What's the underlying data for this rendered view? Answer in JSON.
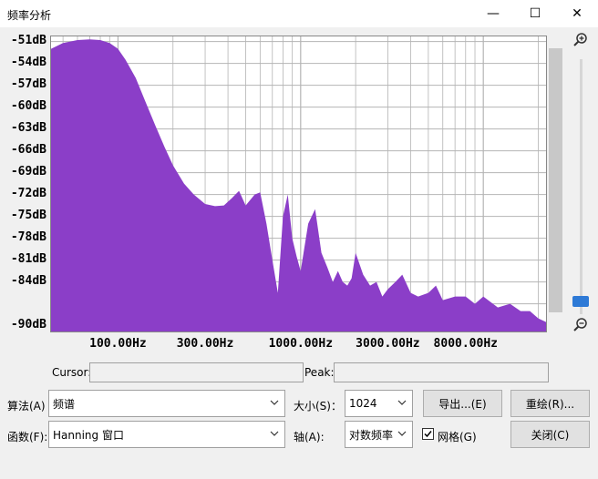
{
  "window": {
    "title": "频率分析",
    "minimize": "—",
    "maximize": "☐",
    "close": "✕"
  },
  "colors": {
    "spectrum": "#8b3ec8",
    "grid": "#b4b4b4"
  },
  "chart_data": {
    "type": "area",
    "y_tick_labels": [
      "-51dB",
      "-54dB",
      "-57dB",
      "-60dB",
      "-63dB",
      "-66dB",
      "-69dB",
      "-72dB",
      "-75dB",
      "-78dB",
      "-81dB",
      "-84dB",
      "-90dB"
    ],
    "x_tick_labels": [
      "100.00Hz",
      "300.00Hz",
      "1000.00Hz",
      "3000.00Hz",
      "8000.00Hz"
    ],
    "ylim": [
      -90,
      -51
    ],
    "xlim_hz": [
      43,
      22050
    ],
    "x_scale": "log",
    "grid": true,
    "x": [
      43,
      50,
      60,
      70,
      80,
      90,
      100,
      110,
      125,
      140,
      160,
      180,
      200,
      230,
      260,
      300,
      340,
      380,
      420,
      460,
      500,
      560,
      600,
      650,
      700,
      750,
      800,
      850,
      900,
      950,
      1000,
      1100,
      1200,
      1300,
      1400,
      1500,
      1600,
      1700,
      1800,
      1900,
      2000,
      2200,
      2400,
      2600,
      2800,
      3000,
      3300,
      3600,
      4000,
      4400,
      5000,
      5500,
      6000,
      7000,
      8000,
      9000,
      10000,
      12000,
      14000,
      16000,
      18000,
      20000,
      22050
    ],
    "y": [
      -52,
      -51.2,
      -50.8,
      -50.7,
      -50.8,
      -51.2,
      -52,
      -53.5,
      -56,
      -59,
      -62.5,
      -65.5,
      -68,
      -70.5,
      -72,
      -73.3,
      -73.6,
      -73.5,
      -72.5,
      -71.5,
      -73.5,
      -72,
      -71.7,
      -76,
      -81,
      -85.5,
      -75,
      -72,
      -78,
      -80.5,
      -82.5,
      -76,
      -74,
      -80,
      -82,
      -84,
      -82.5,
      -84,
      -84.5,
      -83.5,
      -80,
      -83,
      -84.5,
      -84,
      -86,
      -85,
      -84,
      -83,
      -85.5,
      -86,
      -85.5,
      -84.5,
      -86.5,
      -86,
      -86,
      -87,
      -86,
      -87.5,
      -87,
      -88,
      -88,
      -89,
      -89.5
    ]
  },
  "cursor": {
    "label": "Cursor:",
    "value": ""
  },
  "peak": {
    "label": "Peak:",
    "value": ""
  },
  "algorithm": {
    "label": "算法(A)",
    "value": "频谱"
  },
  "function": {
    "label": "函数(F):",
    "value": "Hanning 窗口"
  },
  "size": {
    "label": "大小(S)：",
    "value": "1024"
  },
  "axis": {
    "label": "轴(A):",
    "value": "对数频率"
  },
  "buttons": {
    "export": "导出...(E)",
    "replot": "重绘(R)...",
    "close": "关闭(C)"
  },
  "grid_checkbox": {
    "label": "网格(G)",
    "checked": true
  }
}
